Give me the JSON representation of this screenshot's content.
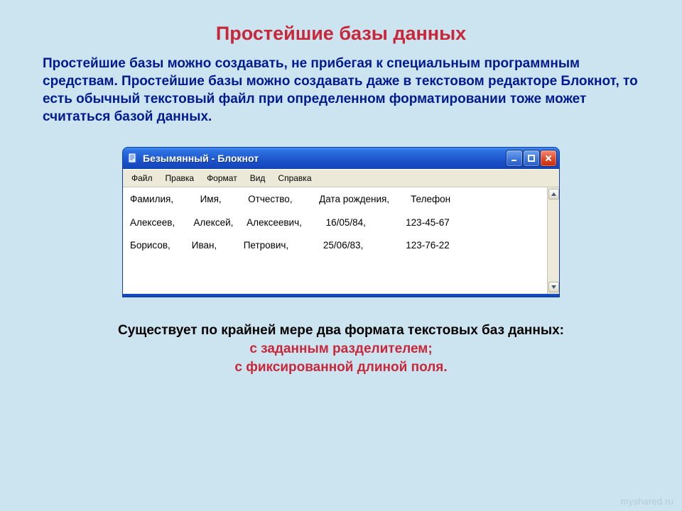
{
  "slide": {
    "title": "Простейшие базы данных",
    "intro": "Простейшие базы можно создавать, не прибегая к специальным программным средствам. Простейшие базы можно создавать даже в текстовом редакторе Блокнот, то есть обычный текстовый файл при определенном форматировании тоже может считаться базой данных.",
    "formats_intro": "Существует по крайней мере два формата текстовых баз данных:",
    "format1": "с заданным разделителем;",
    "format2": "с фиксированной длиной поля."
  },
  "notepad": {
    "title": "Безымянный - Блокнот",
    "menu": [
      "Файл",
      "Правка",
      "Формат",
      "Вид",
      "Справка"
    ],
    "rows": [
      "Фамилия,          Имя,          Отчество,          Дата рождения,        Телефон",
      "",
      "Алексеев,       Алексей,     Алексеевич,         16/05/84,               123-45-67",
      "",
      "Борисов,        Иван,          Петрович,             25/06/83,                123-76-22"
    ]
  },
  "watermark": "myshared.ru"
}
